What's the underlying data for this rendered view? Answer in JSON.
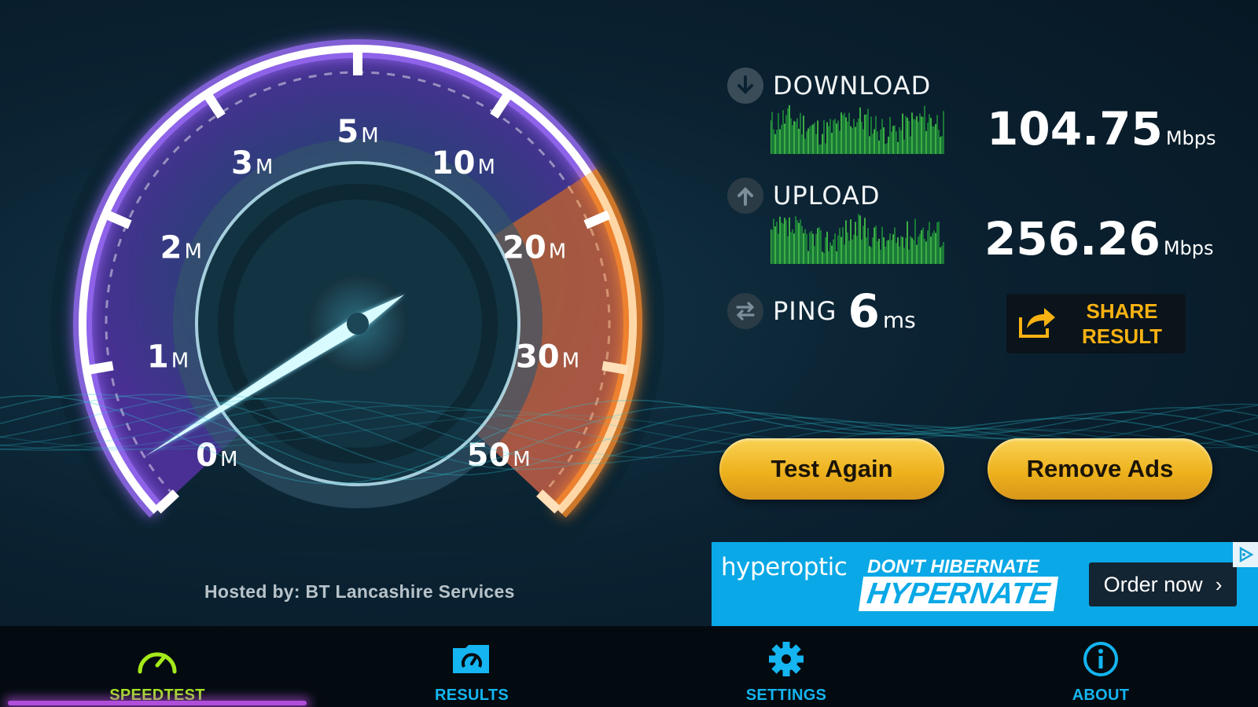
{
  "gauge": {
    "tick_labels": [
      {
        "num": "0",
        "unit": "M"
      },
      {
        "num": "1",
        "unit": "M"
      },
      {
        "num": "2",
        "unit": "M"
      },
      {
        "num": "3",
        "unit": "M"
      },
      {
        "num": "5",
        "unit": "M"
      },
      {
        "num": "10",
        "unit": "M"
      },
      {
        "num": "20",
        "unit": "M"
      },
      {
        "num": "30",
        "unit": "M"
      },
      {
        "num": "50",
        "unit": "M"
      }
    ],
    "colors": {
      "arc": "#ffffff",
      "glow": "#a070ff",
      "dial": "#3b2a7a",
      "hot": "#ff8c2a",
      "needle": "#8fe8ff"
    }
  },
  "download": {
    "label": "DOWNLOAD",
    "value": "104.75",
    "unit": "Mbps",
    "icon": "arrow-down-icon"
  },
  "upload": {
    "label": "UPLOAD",
    "value": "256.26",
    "unit": "Mbps",
    "icon": "arrow-up-icon"
  },
  "ping": {
    "label": "PING",
    "value": "6",
    "unit": "ms",
    "icon": "swap-arrows-icon"
  },
  "share": {
    "line1": "SHARE",
    "line2": "RESULT",
    "icon": "share-icon"
  },
  "buttons": {
    "test_again": "Test Again",
    "remove_ads": "Remove Ads"
  },
  "hosted_by": "Hosted by: BT Lancashire Services",
  "ad": {
    "brand": "hyperoptic",
    "tagline1": "DON'T HIBERNATE",
    "tagline2": "HYPERNATE",
    "cta": "Order now",
    "cta_icon": "chevron-right-icon",
    "choice_icon": "adchoices-icon"
  },
  "nav": {
    "tabs": [
      {
        "label": "SPEEDTEST",
        "icon": "speedometer-icon"
      },
      {
        "label": "RESULTS",
        "icon": "folder-icon"
      },
      {
        "label": "SETTINGS",
        "icon": "gear-icon"
      },
      {
        "label": "ABOUT",
        "icon": "info-icon"
      }
    ],
    "active_color": "#a5ea1a",
    "color": "#14b5f0"
  }
}
